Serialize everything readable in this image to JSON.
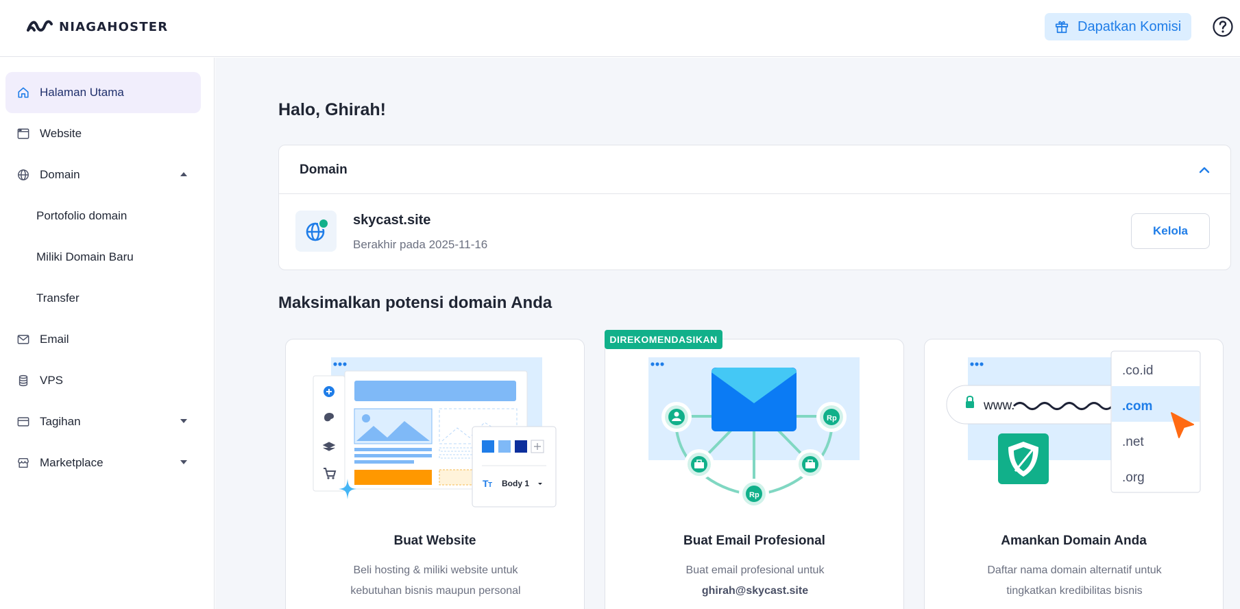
{
  "header": {
    "brand": "NIAGAHOSTER",
    "commission_label": "Dapatkan Komisi"
  },
  "sidebar": {
    "items": [
      {
        "label": "Halaman Utama"
      },
      {
        "label": "Website"
      },
      {
        "label": "Domain"
      },
      {
        "label": "Portofolio domain"
      },
      {
        "label": "Miliki Domain Baru"
      },
      {
        "label": "Transfer"
      },
      {
        "label": "Email"
      },
      {
        "label": "VPS"
      },
      {
        "label": "Tagihan"
      },
      {
        "label": "Marketplace"
      }
    ]
  },
  "main": {
    "greeting": "Halo, Ghirah!",
    "domain_card": {
      "title": "Domain",
      "domain_name": "skycast.site",
      "expiry": "Berakhir pada 2025-11-16",
      "manage_label": "Kelola"
    },
    "section_title": "Maksimalkan potensi domain Anda",
    "badge": "DIREKOMENDASIKAN",
    "cards": [
      {
        "title": "Buat Website",
        "desc_line1": "Beli hosting & miliki website untuk",
        "desc_line2": "kebutuhan bisnis maupun personal",
        "illus_text": "Body 1"
      },
      {
        "title": "Buat Email Profesional",
        "desc_line1": "Buat email profesional untuk",
        "desc_line2": "ghirah@skycast.site",
        "illus_currency": "Rp"
      },
      {
        "title": "Amankan Domain Anda",
        "desc_line1": "Daftar nama domain alternatif untuk",
        "desc_line2": "tingkatkan kredibilitas bisnis",
        "illus_www": "www.",
        "tlds": [
          ".co.id",
          ".com",
          ".net",
          ".org"
        ]
      }
    ]
  },
  "colors": {
    "accent_blue": "#1f7de8",
    "green": "#11b08a",
    "active_nav_bg": "#f1eefc",
    "orange": "#ff6a13"
  }
}
